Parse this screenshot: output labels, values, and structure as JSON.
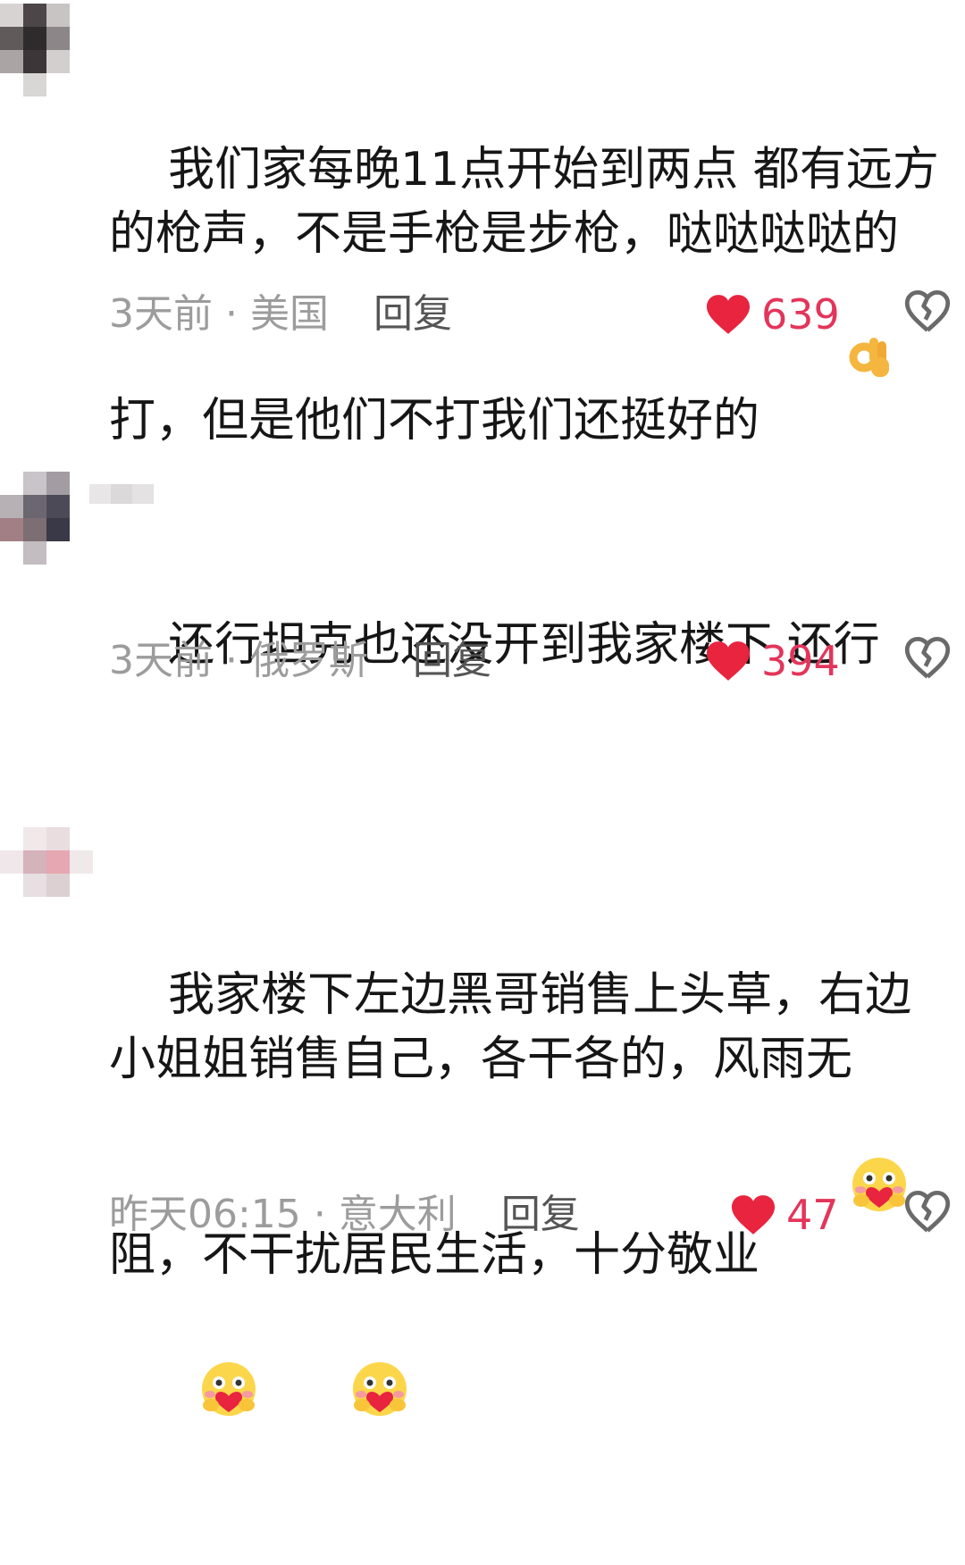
{
  "colors": {
    "text": "#161616",
    "meta": "#9c9c9c",
    "reply": "#555555",
    "like": "#e3355a"
  },
  "comments": [
    {
      "text": "我们家每晚11点开始到两点 都有远方的枪声，不是手枪是步枪，哒哒哒哒的打，但是他们不打我们还挺好的",
      "emoji": "ok-hand-emoji",
      "time": "3天前",
      "location": "美国",
      "reply_label": "回复",
      "likes": "639"
    },
    {
      "text": "还行坦克也还没开到我家楼下 还行",
      "time": "3天前",
      "location": "俄罗斯",
      "reply_label": "回复",
      "likes": "394"
    },
    {
      "text": "我家楼下左边黑哥销售上头草，右边小姐姐销售自己，各干各的，风雨无阻，不干扰居民生活，十分敬业",
      "emoji": "heart-hug-emoji",
      "time": "昨天06:15",
      "location": "意大利",
      "reply_label": "回复",
      "likes": "47"
    }
  ],
  "meta_separator": "·"
}
